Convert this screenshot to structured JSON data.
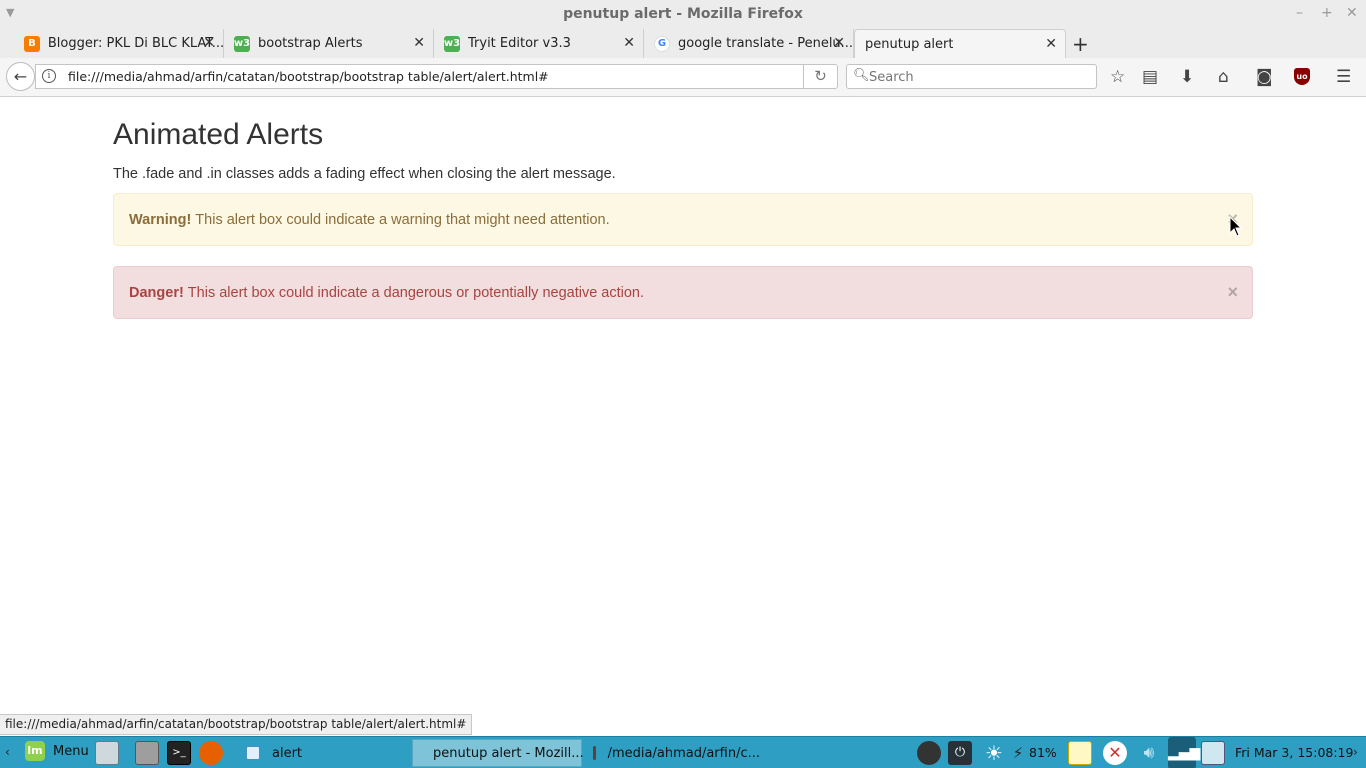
{
  "window": {
    "title": "penutup alert - Mozilla Firefox"
  },
  "tabs": [
    {
      "label": "Blogger: PKL Di BLC KLAT...",
      "icon": "blogger-icon"
    },
    {
      "label": "bootstrap Alerts",
      "icon": "w3schools-icon"
    },
    {
      "label": "Tryit Editor v3.3",
      "icon": "w3schools-icon"
    },
    {
      "label": "google translate - Penelu...",
      "icon": "google-icon"
    },
    {
      "label": "penutup alert",
      "icon": "page-icon"
    }
  ],
  "navbar": {
    "url": "file:///media/ahmad/arfin/catatan/bootstrap/bootstrap table/alert/alert.html#",
    "search_placeholder": "Search"
  },
  "page": {
    "heading": "Animated Alerts",
    "lead": "The .fade and .in classes adds a fading effect when closing the alert message.",
    "alerts": [
      {
        "type": "warning",
        "strong": "Warning!",
        "text": "This alert box could indicate a warning that might need attention.",
        "close": "×",
        "bg": "#fcf8e3",
        "color": "#8a6d3b"
      },
      {
        "type": "danger",
        "strong": "Danger!",
        "text": "This alert box could indicate a dangerous or potentially negative action.",
        "close": "×",
        "bg": "#f2dede",
        "color": "#a94442"
      }
    ]
  },
  "status_url": "file:///media/ahmad/arfin/catatan/bootstrap/bootstrap table/alert/alert.html#",
  "taskbar": {
    "menu_label": "Menu",
    "tasks": [
      {
        "label": "alert",
        "icon": "folder-icon"
      },
      {
        "label": "penutup alert - Mozill...",
        "icon": "firefox-icon"
      },
      {
        "label": "/media/ahmad/arfin/c...",
        "icon": "editor-icon"
      }
    ],
    "battery": "81%",
    "clock": "Fri Mar  3, 15:08:19",
    "accent": "#2e9fc2"
  }
}
